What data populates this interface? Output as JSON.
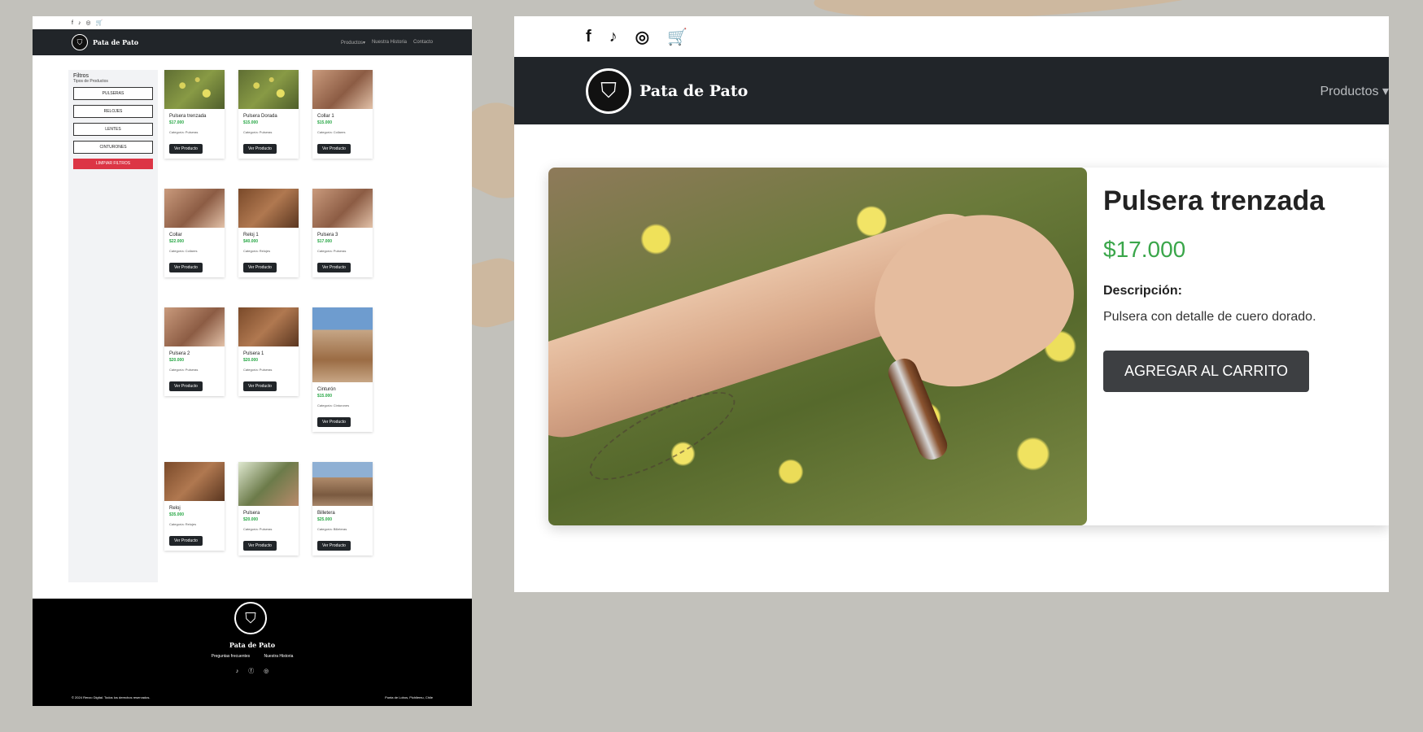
{
  "colors": {
    "accent_green": "#28a745",
    "dark_nav": "#212529",
    "danger": "#dc3545",
    "footer": "#000000"
  },
  "brand": "Pata de Pato",
  "social_icons": [
    "facebook-icon",
    "tiktok-icon",
    "instagram-icon",
    "cart-icon"
  ],
  "small": {
    "nav": {
      "products": "Productos▾",
      "history": "Nuestra Historia",
      "contact": "Contacto"
    },
    "sidebar": {
      "title": "Filtros",
      "subtitle": "Tipos de Productos",
      "filters": [
        "PULSERAS",
        "RELOJES",
        "LENTES",
        "CINTURONES"
      ],
      "clear": "LIMPIAR FILTROS"
    },
    "products": [
      {
        "name": "Pulsera trenzada",
        "price": "$17.000",
        "category": "Categoría: Pulseras",
        "button": "Ver Producto"
      },
      {
        "name": "Pulsera Dorada",
        "price": "$15.000",
        "category": "Categoría: Pulseras",
        "button": "Ver Producto"
      },
      {
        "name": "Collar 1",
        "price": "$15.000",
        "category": "Categoría: Collares",
        "button": "Ver Producto"
      },
      {
        "name": "Collar",
        "price": "$22.000",
        "category": "Categoría: Collares",
        "button": "Ver Producto"
      },
      {
        "name": "Reloj 1",
        "price": "$40.000",
        "category": "Categoría: Relojes",
        "button": "Ver Producto"
      },
      {
        "name": "Pulsera 3",
        "price": "$17.000",
        "category": "Categoría: Pulseras",
        "button": "Ver Producto"
      },
      {
        "name": "Pulsera 2",
        "price": "$20.000",
        "category": "Categoría: Pulseras",
        "button": "Ver Producto"
      },
      {
        "name": "Pulsera 1",
        "price": "$20.000",
        "category": "Categoría: Pulseras",
        "button": "Ver Producto"
      },
      {
        "name": "Cinturón",
        "price": "$15.000",
        "category": "Categoría: Cinturones",
        "button": "Ver Producto"
      },
      {
        "name": "Reloj",
        "price": "$35.000",
        "category": "Categoría: Relojes",
        "button": "Ver Producto"
      },
      {
        "name": "Pulsera",
        "price": "$20.000",
        "category": "Categoría: Pulseras",
        "button": "Ver Producto"
      },
      {
        "name": "Billetera",
        "price": "$25.000",
        "category": "Categoría: Billeteras",
        "button": "Ver Producto"
      }
    ],
    "footer": {
      "brand": "Pata de Pato",
      "links": [
        "Preguntas frecuentes",
        "Nuestra Historia"
      ],
      "copyright": "© 2024 Renzo Digital. Todos los derechos reservados.",
      "location": "Punta de Lobos, Pichilemu, Chile"
    }
  },
  "detail": {
    "nav_products": "Productos ▾",
    "product_title": "Pulsera trenzada",
    "price": "$17.000",
    "description_label": "Descripción:",
    "description": "Pulsera con detalle de cuero dorado.",
    "cart_button": "AGREGAR AL CARRITO"
  }
}
